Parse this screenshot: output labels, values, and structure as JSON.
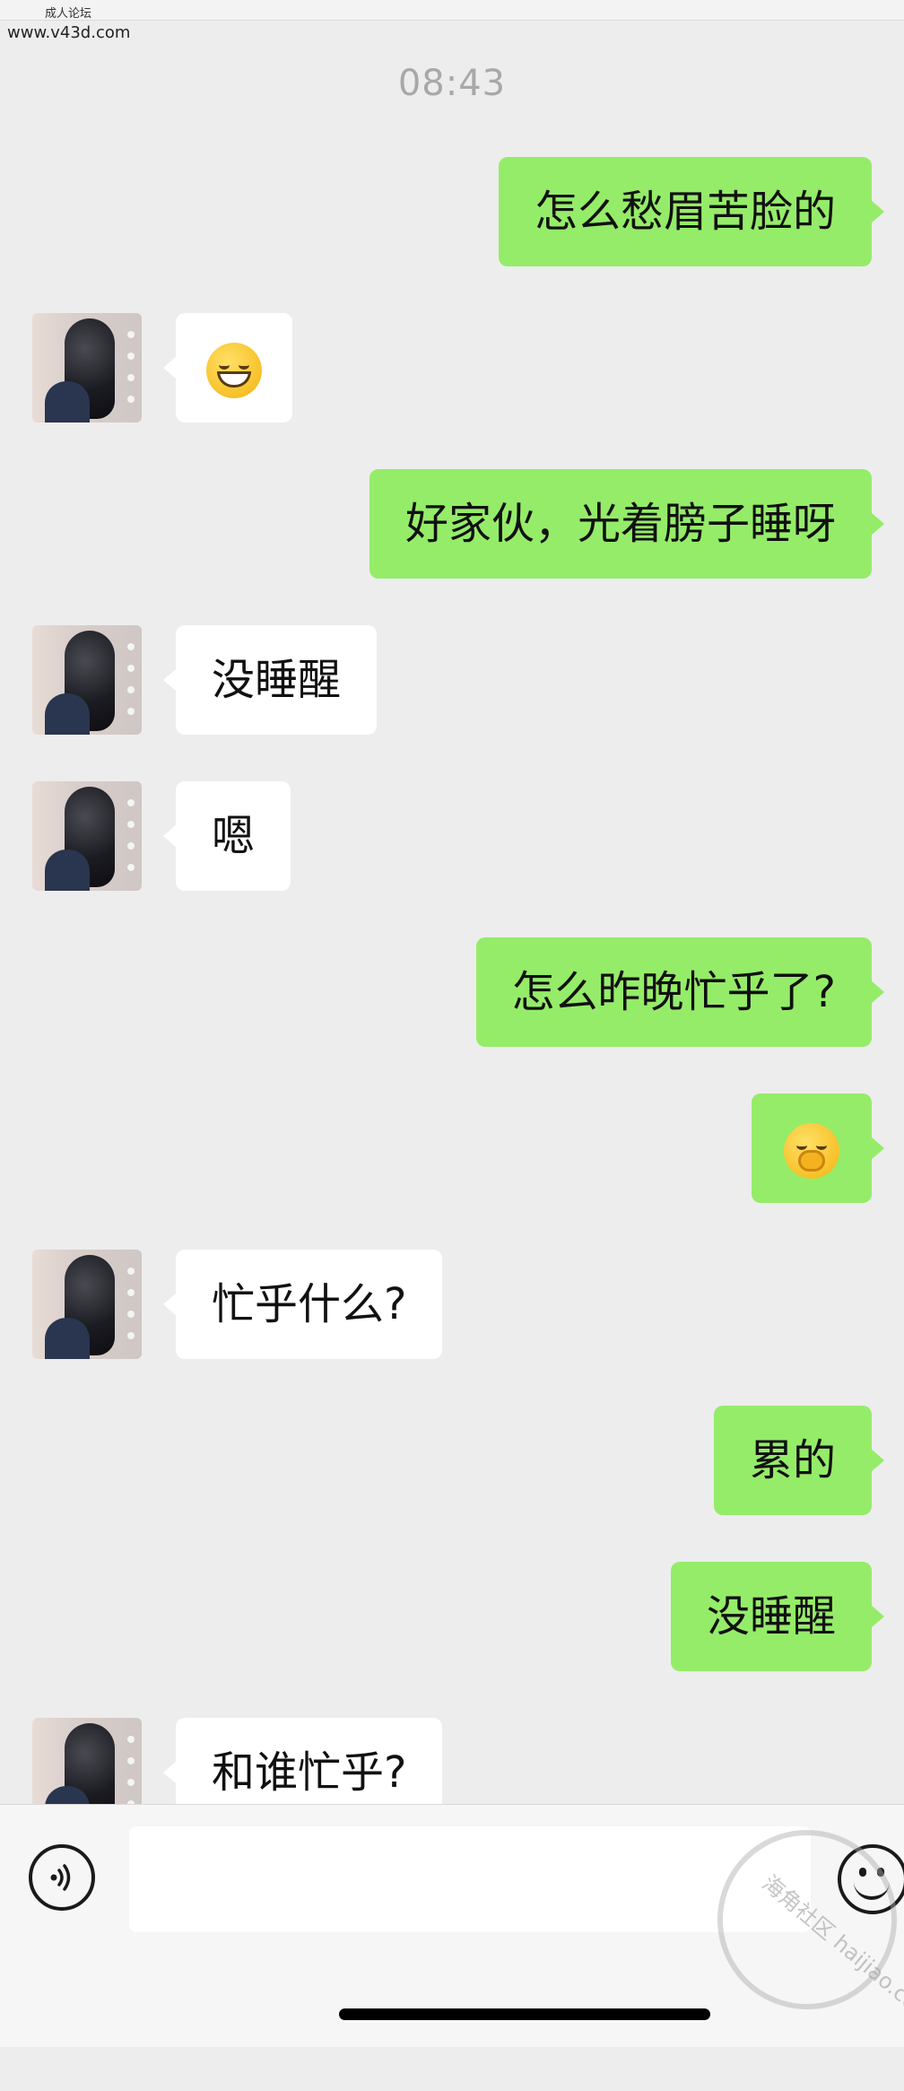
{
  "watermark_top": {
    "title": "成人论坛",
    "url": "www.v43d.com"
  },
  "timestamp": "08:43",
  "messages": [
    {
      "side": "out",
      "text": "怎么愁眉苦脸的"
    },
    {
      "side": "in",
      "emoji": "grinning-face-emoji"
    },
    {
      "side": "out",
      "text": "好家伙，光着膀子睡呀"
    },
    {
      "side": "in",
      "text": "没睡醒"
    },
    {
      "side": "in",
      "text": "嗯"
    },
    {
      "side": "out",
      "text": "怎么昨晚忙乎了?"
    },
    {
      "side": "out",
      "emoji": "face-with-hand-over-mouth-emoji"
    },
    {
      "side": "in",
      "text": "忙乎什么?"
    },
    {
      "side": "out",
      "text": "累的"
    },
    {
      "side": "out",
      "text": "没睡醒"
    },
    {
      "side": "in",
      "text": "和谁忙乎?"
    }
  ],
  "input_bar": {
    "voice_icon": "voice-wave-icon",
    "text_value": "",
    "emoji_icon": "smiley-icon"
  },
  "watermark_bottom": {
    "text": "海角社区 haijiao.com"
  }
}
